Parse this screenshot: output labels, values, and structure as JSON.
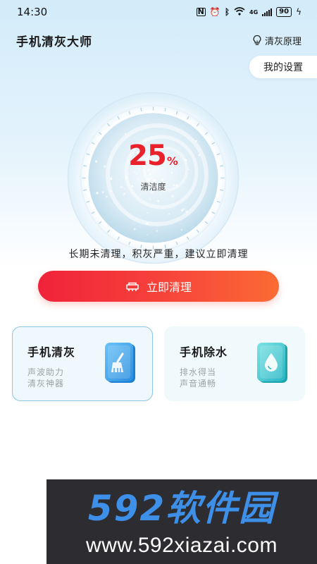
{
  "status": {
    "time": "14:30",
    "network": "4G",
    "battery": "90"
  },
  "header": {
    "title": "手机清灰大师",
    "principle_label": "清灰原理",
    "settings_label": "我的设置"
  },
  "gauge": {
    "value": "25",
    "unit": "%",
    "label": "清洁度",
    "level": 0.25
  },
  "advice": "长期未清理，积灰严重，建议立即清理",
  "action": {
    "label": "立即清理"
  },
  "cards": [
    {
      "title": "手机清灰",
      "line1": "声波助力",
      "line2": "清灰神器",
      "icon": "broom-phone-icon",
      "selected": true
    },
    {
      "title": "手机除水",
      "line1": "排水得当",
      "line2": "声音通畅",
      "icon": "water-drop-phone-icon",
      "selected": false
    }
  ],
  "watermark": {
    "logo_text": "592软件园",
    "url": "www.592xiazai.com"
  },
  "colors": {
    "accent": "#f0223a",
    "accent_end": "#fb6b34",
    "card_border": "#8ec6e4",
    "logo_blue": "#3d8fe8"
  }
}
